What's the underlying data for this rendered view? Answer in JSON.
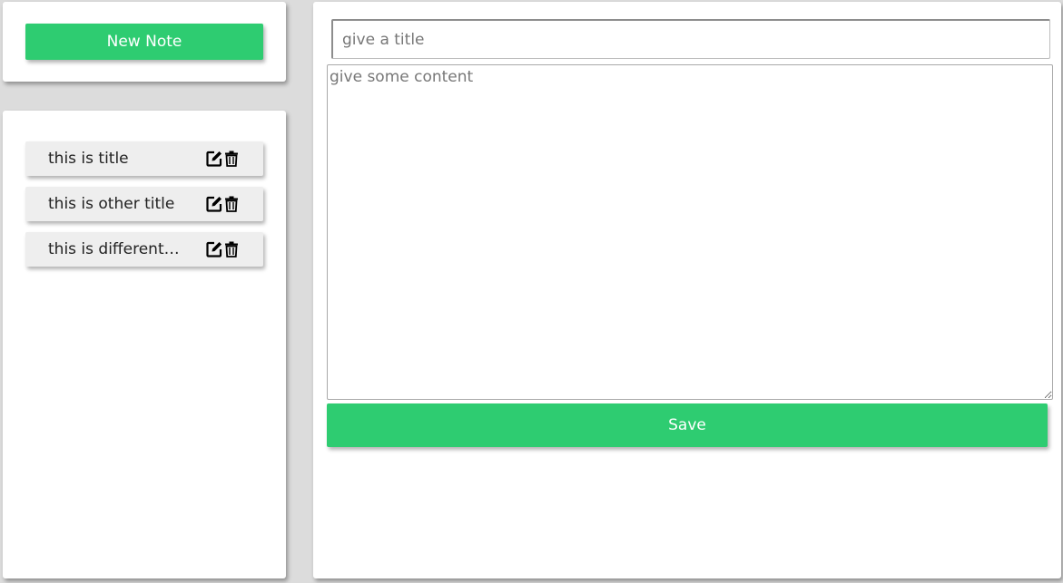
{
  "sidebar": {
    "new_note_label": "New Note",
    "notes": [
      {
        "title": "this is title",
        "edit_icon": "edit-icon",
        "delete_icon": "trash-icon"
      },
      {
        "title": "this is other title",
        "edit_icon": "edit-icon",
        "delete_icon": "trash-icon"
      },
      {
        "title": "this is different tit...",
        "edit_icon": "edit-icon",
        "delete_icon": "trash-icon"
      }
    ]
  },
  "editor": {
    "title_value": "",
    "title_placeholder": "give a title",
    "content_value": "",
    "content_placeholder": "give some content",
    "save_label": "Save"
  },
  "colors": {
    "accent": "#2ecc71",
    "background": "#dcdcdc",
    "card": "#ffffff",
    "note_item": "#eeeeee"
  }
}
